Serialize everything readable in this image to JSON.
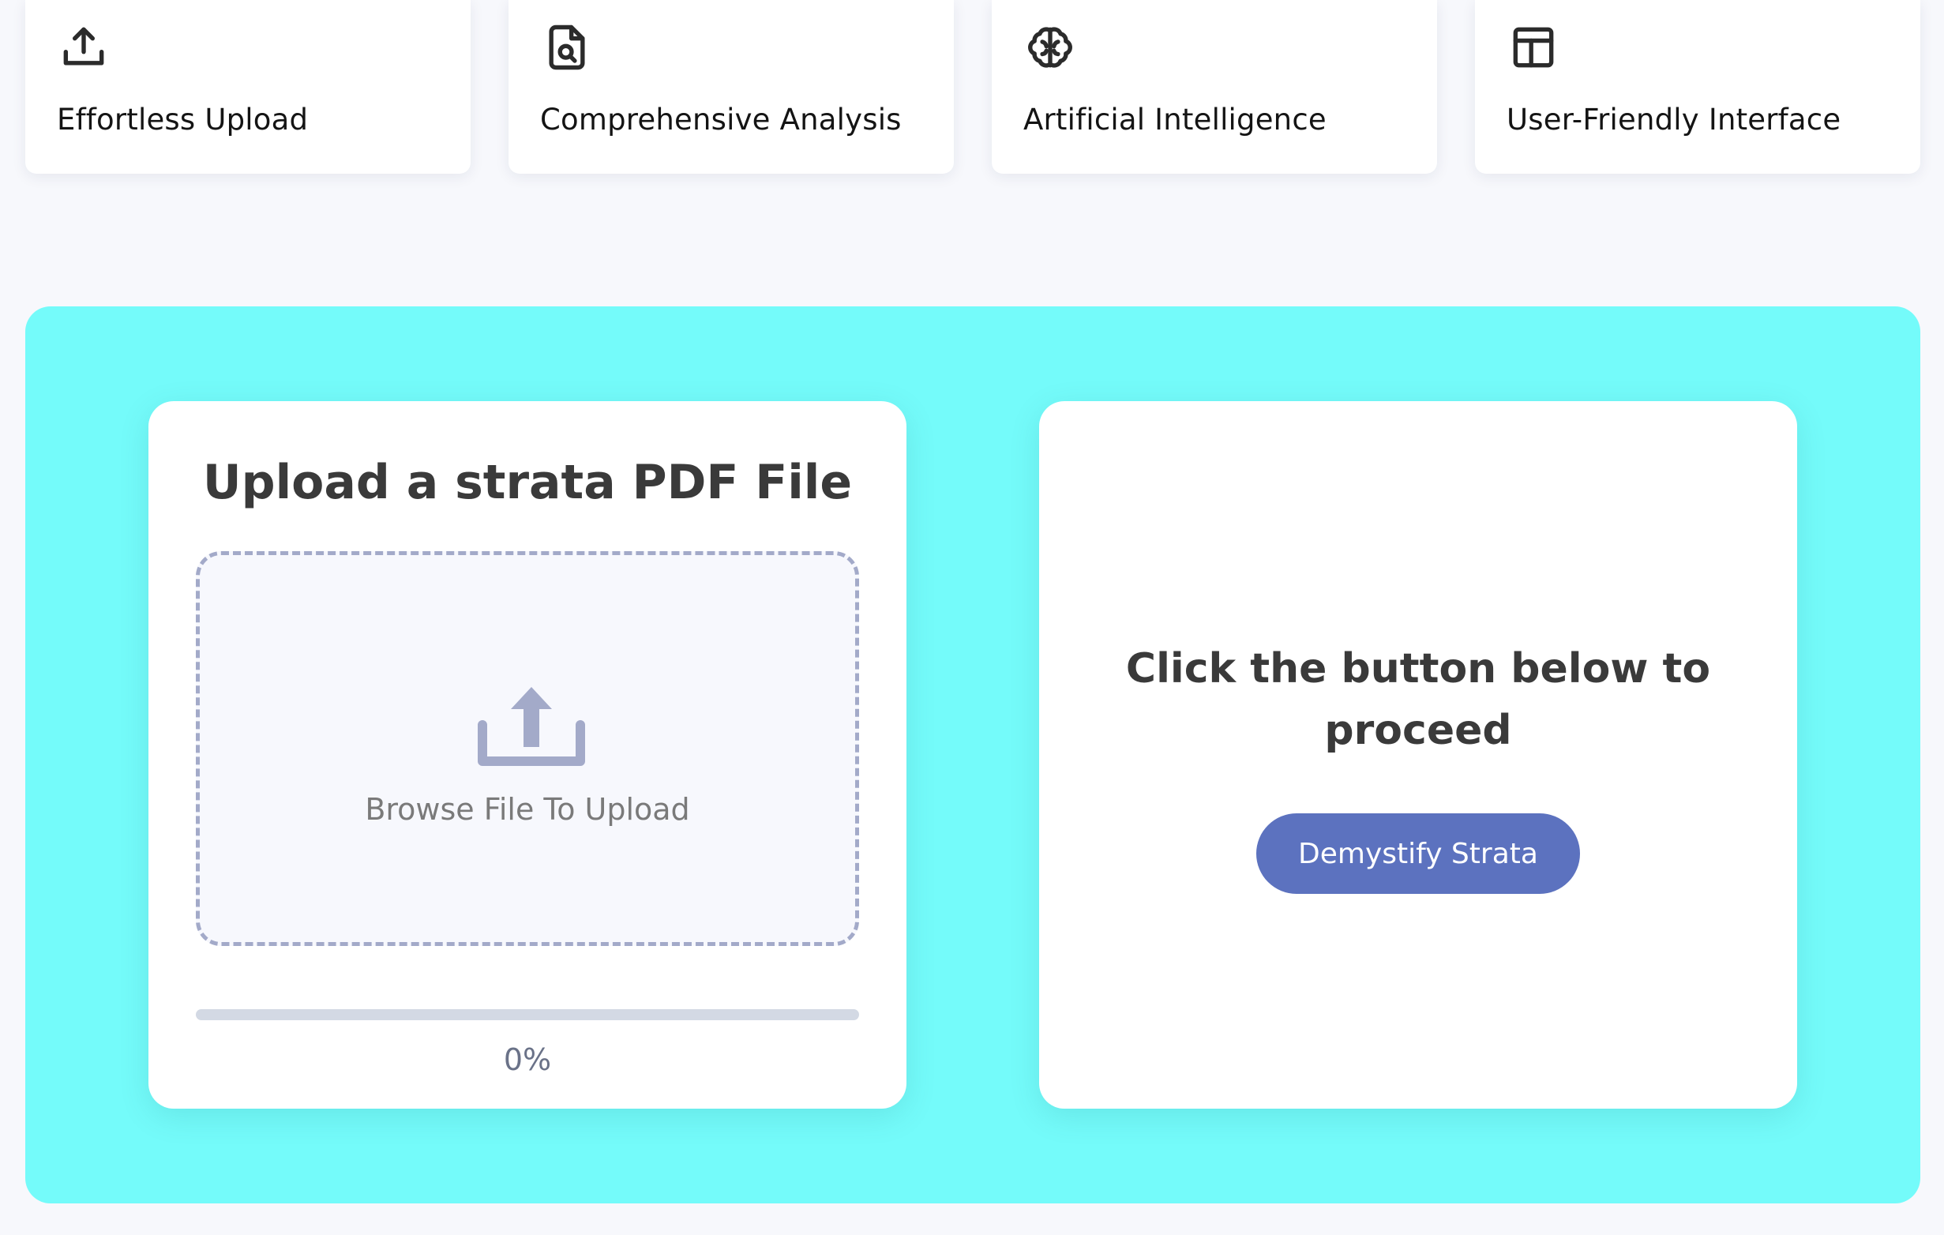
{
  "features": [
    {
      "title": "Effortless Upload",
      "icon": "upload-icon"
    },
    {
      "title": "Comprehensive Analysis",
      "icon": "document-search-icon"
    },
    {
      "title": "Artificial Intelligence",
      "icon": "brain-icon"
    },
    {
      "title": "User-Friendly Interface",
      "icon": "layout-icon"
    }
  ],
  "upload_panel": {
    "title": "Upload a strata PDF File",
    "dropzone_label": "Browse File To Upload",
    "dropzone_icon": "upload-icon",
    "progress_percent": 0,
    "progress_text": "0%"
  },
  "proceed_panel": {
    "message": "Click the button below to proceed",
    "button_label": "Demystify Strata"
  },
  "colors": {
    "page_background": "#f7f8fc",
    "section_background": "#74fbfa",
    "accent": "#5c72bf",
    "dropzone_border": "#a3aac9",
    "progress_track": "#d3d9e4"
  }
}
